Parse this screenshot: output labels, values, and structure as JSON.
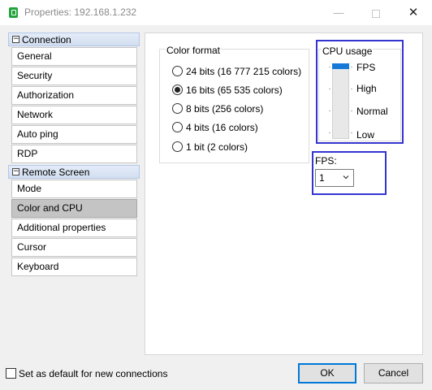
{
  "window": {
    "title": "Properties: 192.168.1.232"
  },
  "sidebar": {
    "groups": [
      {
        "label": "Connection",
        "toggle": "−"
      },
      {
        "label": "Remote Screen",
        "toggle": "−"
      }
    ],
    "items": [
      "General",
      "Security",
      "Authorization",
      "Network",
      "Auto ping",
      "RDP",
      "Mode",
      "Color and CPU",
      "Additional properties",
      "Cursor",
      "Keyboard"
    ],
    "selected": "Color and CPU"
  },
  "color_format": {
    "title": "Color format",
    "options": [
      "24 bits (16 777 215 colors)",
      "16 bits (65 535 colors)",
      "8 bits (256 colors)",
      "4 bits (16 colors)",
      "1 bit (2 colors)"
    ],
    "selected": "16 bits (65 535 colors)"
  },
  "cpu_usage": {
    "title": "CPU usage",
    "levels": [
      "FPS",
      "High",
      "Normal",
      "Low"
    ],
    "selected": "FPS",
    "accent": "#1479d7"
  },
  "fps": {
    "label": "FPS:",
    "value": "1"
  },
  "footer": {
    "default_checkbox_label": "Set as default for new connections",
    "ok": "OK",
    "cancel": "Cancel"
  },
  "colors": {
    "highlight_border": "#3434d2",
    "ok_border": "#0078d7"
  }
}
